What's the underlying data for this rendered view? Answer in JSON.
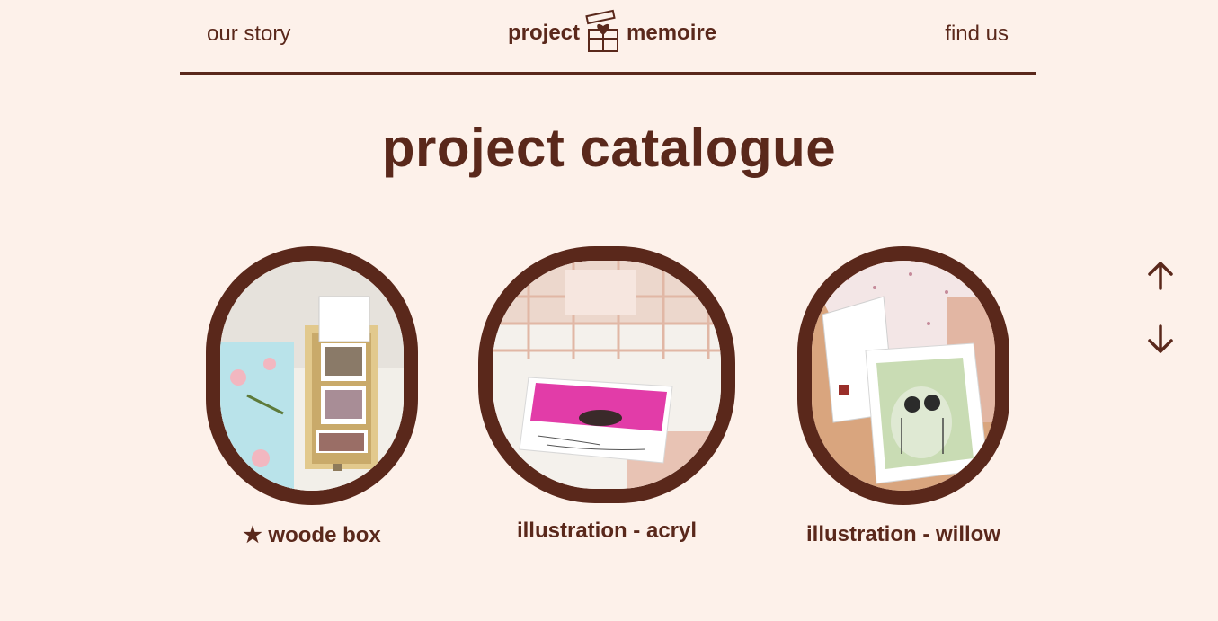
{
  "nav": {
    "left_label": "our story",
    "right_label": "find us",
    "logo_left": "project",
    "logo_right": "memoire"
  },
  "page_title": "project catalogue",
  "products": [
    {
      "label": "★ woode box",
      "icon": "wooden-box-photo"
    },
    {
      "label": "illustration - acryl",
      "icon": "acrylic-illustration-photo"
    },
    {
      "label": "illustration - willow",
      "icon": "willow-frame-photo"
    }
  ],
  "scroll_controls": {
    "up_icon": "arrow-up-icon",
    "down_icon": "arrow-down-icon"
  },
  "colors": {
    "background": "#fdf1ea",
    "brand": "#5a281b",
    "accent_pink": "#e23ca8"
  }
}
